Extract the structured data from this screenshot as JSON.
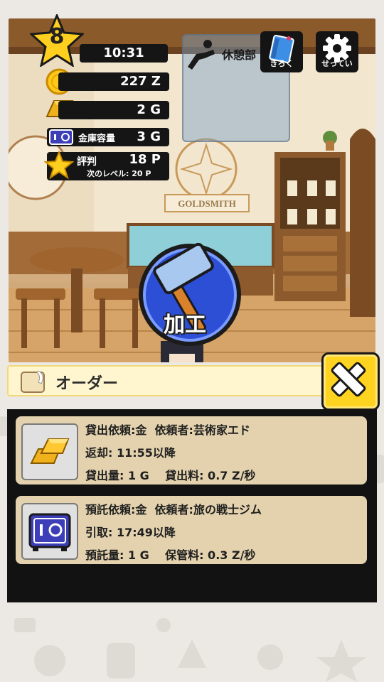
{
  "hud": {
    "level": "8",
    "time": "10:31",
    "gold_amount": "227 Z",
    "gold_bars": "2 G",
    "vault_label": "金庫容量",
    "vault_value": "3 G",
    "reputation_label": "評判",
    "reputation_value": "18 P",
    "next_level": "次のレベル: 20 P",
    "rest_room_label": "休憩部",
    "record_button": "きろく",
    "settings_button": "せってい",
    "craft_button": "加工"
  },
  "scene": {
    "shop_sign": "GOLDSMITH"
  },
  "order_panel": {
    "title": "オーダー",
    "orders": [
      {
        "line1": "貸出依頼:金  依頼者:芸術家エド",
        "line2": "返却: 11:55以降",
        "line3": "貸出量: 1 G    貸出料: 0.7 Z/秒",
        "icon": "gold-bars-icon"
      },
      {
        "line1": "預託依頼:金  依頼者:旅の戦士ジム",
        "line2": "引取: 17:49以降",
        "line3": "預託量: 1 G    保管料: 0.3 Z/秒",
        "icon": "vault-icon"
      }
    ]
  },
  "colors": {
    "accent_yellow": "#ffd420",
    "card_bg": "#e3d2ad",
    "craft_blue": "#2c4fd6"
  }
}
